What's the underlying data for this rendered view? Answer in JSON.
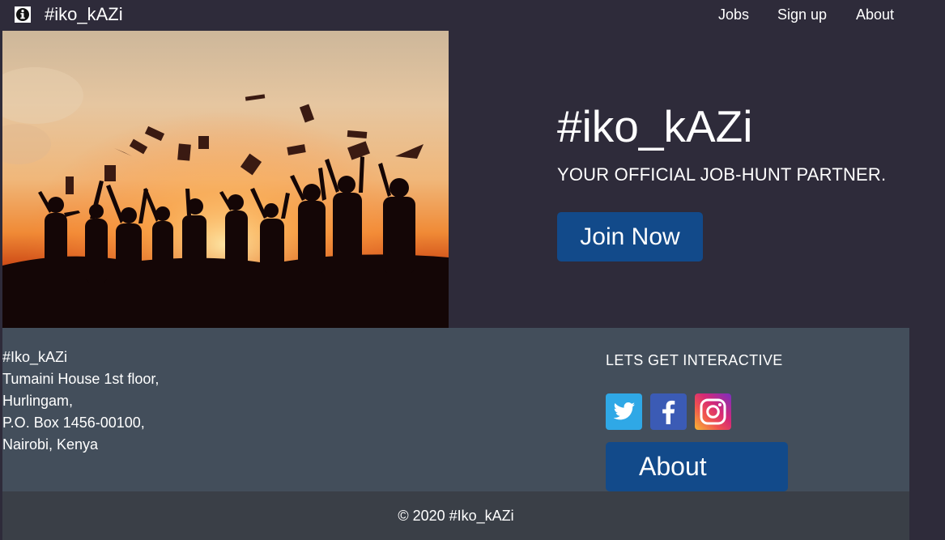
{
  "brand": {
    "name": "#iko_kAZi",
    "icon": "info-circle-icon"
  },
  "nav": {
    "items": [
      {
        "label": "Jobs"
      },
      {
        "label": "Sign up"
      },
      {
        "label": "About"
      }
    ]
  },
  "hero": {
    "image": "graduates-silhouette-sunset",
    "title": "#iko_kAZi",
    "subtitle": "YOUR OFFICIAL JOB-HUNT PARTNER.",
    "cta_label": "Join Now"
  },
  "footer": {
    "address": [
      "#Iko_kAZi",
      "Tumaini House 1st floor,",
      "Hurlingam,",
      "P.O. Box 1456-00100,",
      "Nairobi, Kenya"
    ],
    "social_heading": "LETS GET INTERACTIVE",
    "social": [
      {
        "name": "twitter",
        "icon": "twitter-icon",
        "color": "#2fa8e6"
      },
      {
        "name": "facebook",
        "icon": "facebook-icon",
        "color": "#3b5bb5"
      },
      {
        "name": "instagram",
        "icon": "instagram-icon",
        "color": "#d62976"
      }
    ],
    "about_label": "About",
    "copyright": "© 2020 #Iko_kAZi"
  },
  "colors": {
    "page_bg": "#2e2b3a",
    "footer_bg": "#434e5b",
    "copyright_bg": "#3a3f47",
    "button": "#124a8a"
  }
}
